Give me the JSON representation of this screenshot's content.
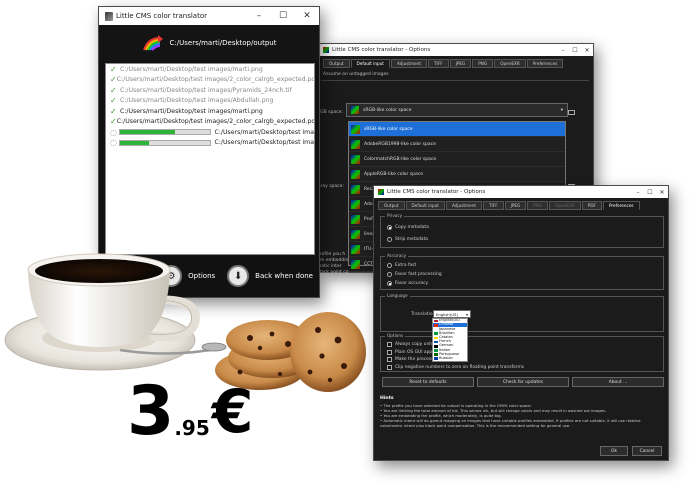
{
  "main_window": {
    "title": "Little CMS color translator",
    "output_path": "C:/Users/marti/Desktop/output",
    "files": [
      {
        "status": "done",
        "name": "C:/Users/marti/Desktop/test images/marti.png"
      },
      {
        "status": "done",
        "name": "C:/Users/marti/Desktop/test images/2_color_calrgb_expected.pdf.0.p"
      },
      {
        "status": "done",
        "name": "C:/Users/marti/Desktop/test images/Pyramids_24nch.tif"
      },
      {
        "status": "done",
        "name": "C:/Users/marti/Desktop/test images/Abdullah.png"
      },
      {
        "status": "done",
        "name": "C:/Users/marti/Desktop/test images/marti.png"
      },
      {
        "status": "done",
        "name": "C:/Users/marti/Desktop/test images/2_color_calrgb_expected.pdf.0.p"
      }
    ],
    "in_progress": [
      {
        "name": "C:/Users/marti/Desktop/test ima",
        "progress": 0.62
      },
      {
        "name": "C:/Users/marti/Desktop/test ima",
        "progress": 0.32
      }
    ],
    "options_label": "Options",
    "back_label": "Back when done"
  },
  "options1": {
    "title": "Little CMS color translator - Options",
    "tabs": [
      "Output",
      "Default input",
      "Adjustment",
      "TIFF",
      "JPEG",
      "PNG",
      "OpenEXR",
      "Preferences"
    ],
    "active_tab": "Default input",
    "section_label": "Assume on untagged images",
    "rgb_label": "RGB space:",
    "rgb_value": "sRGB-like color space",
    "gray_label": "Gray space:",
    "profiles": [
      "sRGB-like color space",
      "AdobeRGB1998-like color space",
      "ColormatchRGB-like color space",
      "AppleRGB-like color space",
      "Rec2020",
      "Adobe",
      "ProPho",
      "linear",
      "ITU-R",
      "CCTVW"
    ],
    "partial_texts": [
      "profile you h",
      "are embeddin",
      "matic inter",
      "black point co"
    ]
  },
  "options2": {
    "title": "Little CMS color translator - Options",
    "tabs": [
      "Output",
      "Default input",
      "Adjustment",
      "TIFF",
      "JPEG",
      "PNG",
      "OpenEXR",
      "PDF",
      "Preferences"
    ],
    "active_tab": "Preferences",
    "disabled_tabs": [
      "PNG",
      "OpenEXR"
    ],
    "privacy": {
      "title": "Privacy",
      "opt1": "Copy metadata",
      "opt2": "Strip metadata"
    },
    "accuracy": {
      "title": "Accuracy",
      "opt1": "Extra fast",
      "opt2": "Favor fast processing",
      "opt3": "Favor accuracy"
    },
    "language": {
      "title": "Language",
      "label": "Translation:",
      "value": "English(US)"
    },
    "languages": [
      {
        "name": "English(US)",
        "c": "#b22234"
      },
      {
        "name": "Chinese",
        "c": "#de2910"
      },
      {
        "name": "Japanese",
        "c": "#ffffff"
      },
      {
        "name": "Brazilian",
        "c": "#009c3b"
      },
      {
        "name": "Catalan",
        "c": "#fcdd09"
      },
      {
        "name": "French",
        "c": "#0055a4"
      },
      {
        "name": "German",
        "c": "#000000"
      },
      {
        "name": "Italian",
        "c": "#009246"
      },
      {
        "name": "Portuguese",
        "c": "#006600"
      },
      {
        "name": "Russian",
        "c": "#0039a6"
      }
    ],
    "options_group": {
      "title": "Options",
      "items": [
        "Always copy unhandled",
        "Plain OS GUI appearanc",
        "Make the processing ve",
        "Clip negative numbers to zero on floating point transforms"
      ]
    },
    "buttons": {
      "reset": "Reset to defaults",
      "check": "Check for updates",
      "about": "About ..."
    },
    "hints": {
      "title": "Hints",
      "lines": [
        "• The profile you have selected for output is operating in the CMYK color space.",
        "• You are limiting the total amount of ink. This serves ink, but will change colors and may result in washed out images.",
        "• You are embedding the profile, which moderately, is quite big.",
        "• Automatic intent will do gamut mapping on images that have suitable profiles embedded. If profiles are not suitable, it will use relative colorimetric intent plus black point compensation. This is the recommended setting for general use."
      ]
    },
    "ok": "Ok",
    "cancel": "Cancel"
  },
  "price": {
    "integer": "3",
    "decimal": ".95",
    "currency": "€"
  }
}
